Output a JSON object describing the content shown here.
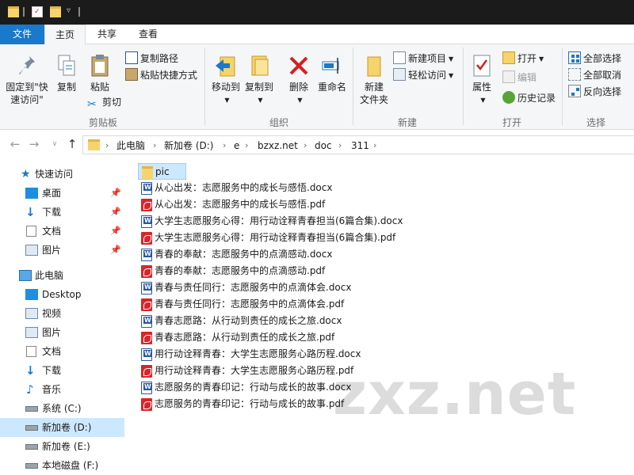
{
  "tabs": {
    "file": "文件",
    "home": "主页",
    "share": "共享",
    "view": "查看"
  },
  "ribbon": {
    "clipboard": {
      "group_label": "剪贴板",
      "pin_quick_access_line1": "固定到\"快",
      "pin_quick_access_line2": "速访问\"",
      "copy": "复制",
      "paste": "粘贴",
      "copy_path": "复制路径",
      "paste_shortcut": "粘贴快捷方式",
      "cut": "剪切"
    },
    "organize": {
      "group_label": "组织",
      "move_to": "移动到",
      "copy_to": "复制到",
      "delete": "删除",
      "rename": "重命名"
    },
    "new": {
      "group_label": "新建",
      "new_folder_line1": "新建",
      "new_folder_line2": "文件夹",
      "new_item": "新建项目",
      "easy_access": "轻松访问"
    },
    "open": {
      "group_label": "打开",
      "properties": "属性",
      "open": "打开",
      "edit": "编辑",
      "history": "历史记录"
    },
    "select": {
      "group_label": "选择",
      "select_all": "全部选择",
      "select_none": "全部取消",
      "invert": "反向选择"
    }
  },
  "address": {
    "breadcrumbs": [
      "此电脑",
      "新加卷 (D:)",
      "e",
      "bzxz.net",
      "doc",
      "311"
    ]
  },
  "sidebar": {
    "quick_access": "快速访问",
    "qa_items": [
      "桌面",
      "下载",
      "文档",
      "图片"
    ],
    "this_pc": "此电脑",
    "pc_items": [
      "Desktop",
      "视频",
      "图片",
      "文档",
      "下载",
      "音乐",
      "系统 (C:)",
      "新加卷 (D:)",
      "新加卷 (E:)",
      "本地磁盘 (F:)"
    ]
  },
  "files": [
    {
      "name": "pic",
      "type": "folder"
    },
    {
      "name": "从心出发：志愿服务中的成长与感悟.docx",
      "type": "docx"
    },
    {
      "name": "从心出发：志愿服务中的成长与感悟.pdf",
      "type": "pdf"
    },
    {
      "name": "大学生志愿服务心得：用行动诠释青春担当(6篇合集).docx",
      "type": "docx"
    },
    {
      "name": "大学生志愿服务心得：用行动诠释青春担当(6篇合集).pdf",
      "type": "pdf"
    },
    {
      "name": "青春的奉献：志愿服务中的点滴感动.docx",
      "type": "docx"
    },
    {
      "name": "青春的奉献：志愿服务中的点滴感动.pdf",
      "type": "pdf"
    },
    {
      "name": "青春与责任同行：志愿服务中的点滴体会.docx",
      "type": "docx"
    },
    {
      "name": "青春与责任同行：志愿服务中的点滴体会.pdf",
      "type": "pdf"
    },
    {
      "name": "青春志愿路：从行动到责任的成长之旅.docx",
      "type": "docx"
    },
    {
      "name": "青春志愿路：从行动到责任的成长之旅.pdf",
      "type": "pdf"
    },
    {
      "name": "用行动诠释青春：大学生志愿服务心路历程.docx",
      "type": "docx"
    },
    {
      "name": "用行动诠释青春：大学生志愿服务心路历程.pdf",
      "type": "pdf"
    },
    {
      "name": "志愿服务的青春印记：行动与成长的故事.docx",
      "type": "docx"
    },
    {
      "name": "志愿服务的青春印记：行动与成长的故事.pdf",
      "type": "pdf"
    }
  ],
  "watermark": "zxz.net",
  "colors": {
    "accent": "#1979ca",
    "selection": "#cce8ff",
    "pdf": "#d7262b",
    "word": "#2b579a",
    "folder": "#f7d36b"
  }
}
